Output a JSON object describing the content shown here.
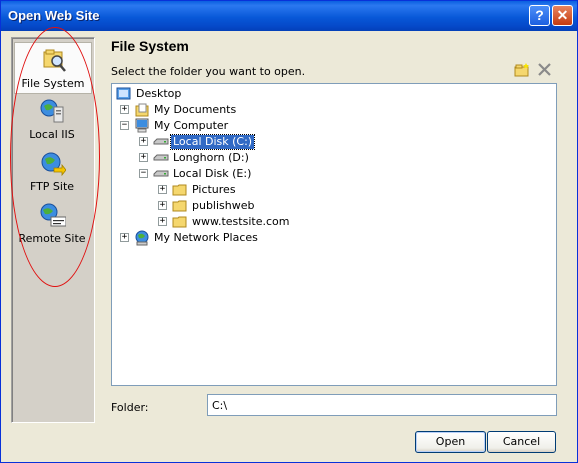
{
  "window": {
    "title": "Open Web Site"
  },
  "title_buttons": {
    "help": "?",
    "close": "✕"
  },
  "places": [
    {
      "label": "File System",
      "icon": "file-system-icon",
      "selected": true
    },
    {
      "label": "Local IIS",
      "icon": "local-iis-icon",
      "selected": false
    },
    {
      "label": "FTP Site",
      "icon": "ftp-site-icon",
      "selected": false
    },
    {
      "label": "Remote Site",
      "icon": "remote-site-icon",
      "selected": false
    }
  ],
  "main": {
    "heading": "File System",
    "instruction": "Select the folder you want to open."
  },
  "tree": {
    "desktop": "Desktop",
    "my_documents": "My Documents",
    "my_computer": "My Computer",
    "local_c": "Local Disk (C:)",
    "longhorn_d": "Longhorn (D:)",
    "local_e": "Local Disk (E:)",
    "pictures": "Pictures",
    "publishweb": "publishweb",
    "testsite": "www.testsite.com",
    "network": "My Network Places",
    "expander_plus": "+",
    "expander_minus": "−"
  },
  "folder": {
    "label": "Folder:",
    "value": "C:\\"
  },
  "buttons": {
    "open": "Open",
    "cancel": "Cancel"
  },
  "colors": {
    "title_bar": "#0858d8",
    "selection": "#316ac5",
    "annotation": "#e01010"
  }
}
